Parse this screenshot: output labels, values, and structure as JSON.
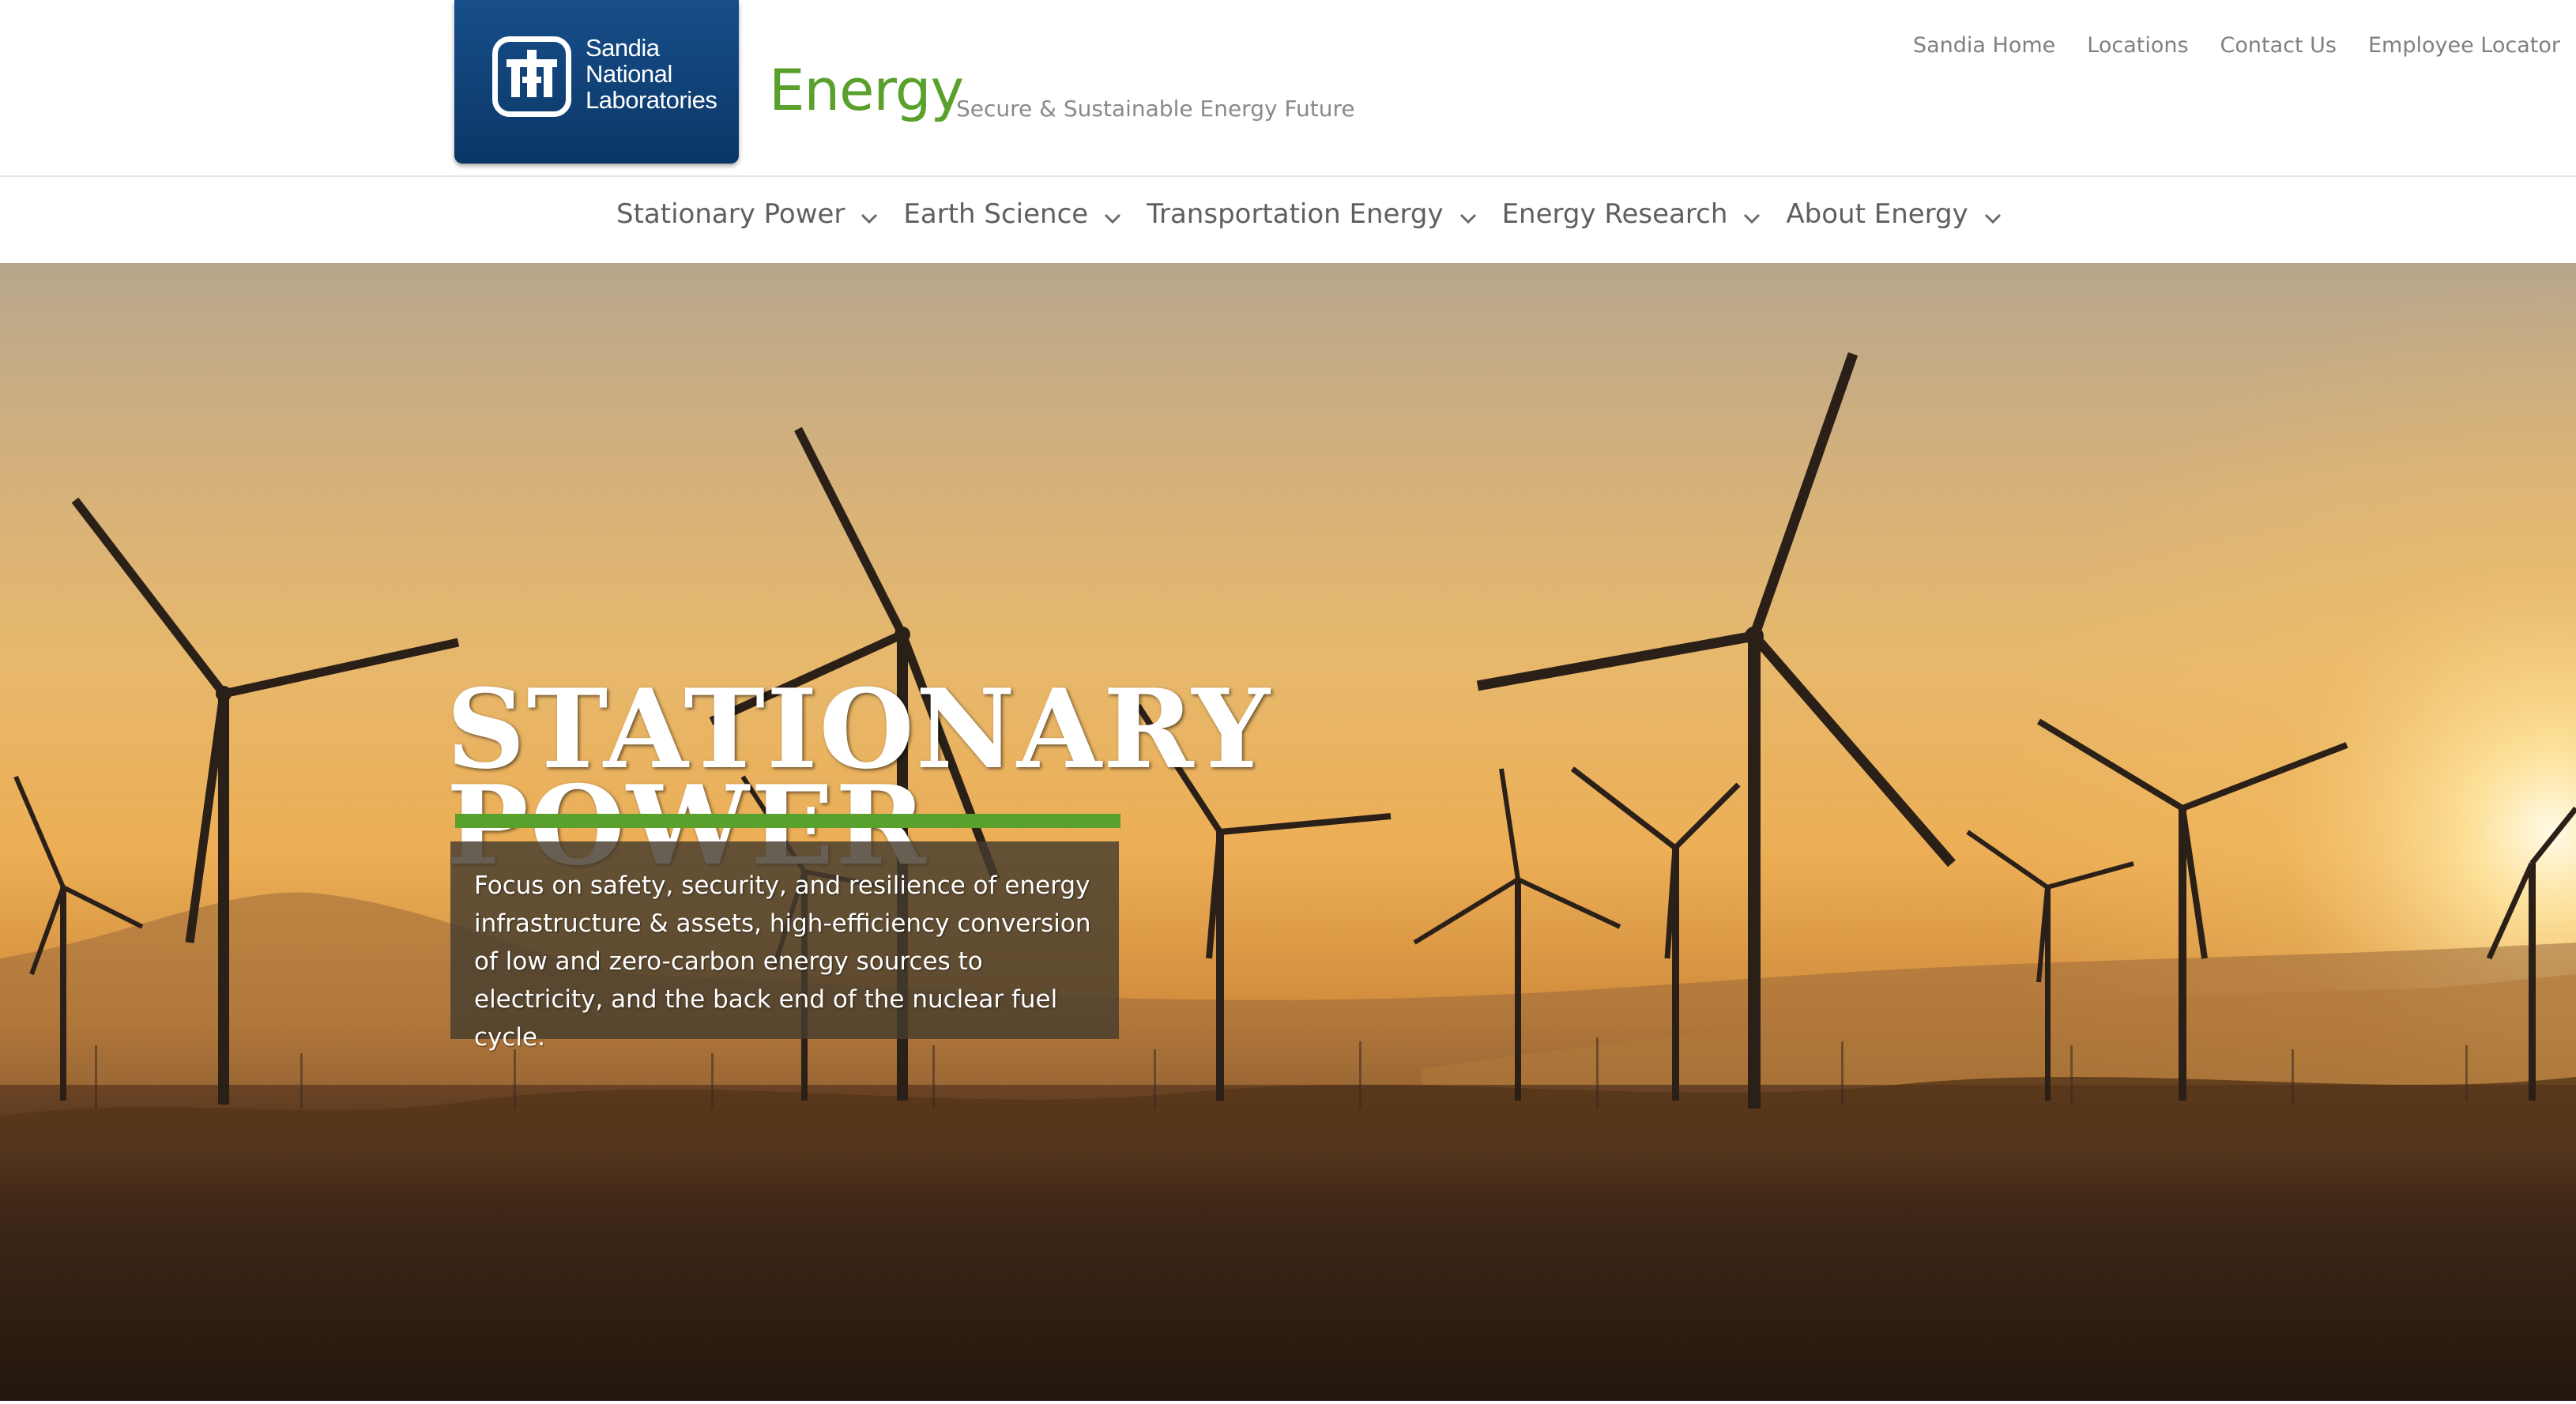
{
  "logo": {
    "line1": "Sandia",
    "line2": "National",
    "line3": "Laboratories"
  },
  "site": {
    "title": "Energy",
    "tagline": "Secure & Sustainable Energy Future"
  },
  "utility_nav": [
    "Sandia Home",
    "Locations",
    "Contact Us",
    "Employee Locator"
  ],
  "main_nav": [
    {
      "label": "Stationary Power",
      "icon": "chevron-down-icon"
    },
    {
      "label": "Earth Science",
      "icon": "chevron-down-icon"
    },
    {
      "label": "Transportation Energy",
      "icon": "chevron-down-icon"
    },
    {
      "label": "Energy Research",
      "icon": "chevron-down-icon"
    },
    {
      "label": "About Energy",
      "icon": "chevron-down-icon"
    }
  ],
  "hero": {
    "title_line1": "STATIONARY",
    "title_line2": "POWER",
    "description": "Focus on safety, security, and resilience of energy infrastructure & assets, high-efficiency conversion of low and zero-carbon energy sources to electricity, and the back end of the nuclear fuel cycle."
  },
  "colors": {
    "accent_green": "#5aa02c",
    "logo_blue": "#0c3766",
    "nav_text": "#5f5f5f"
  }
}
